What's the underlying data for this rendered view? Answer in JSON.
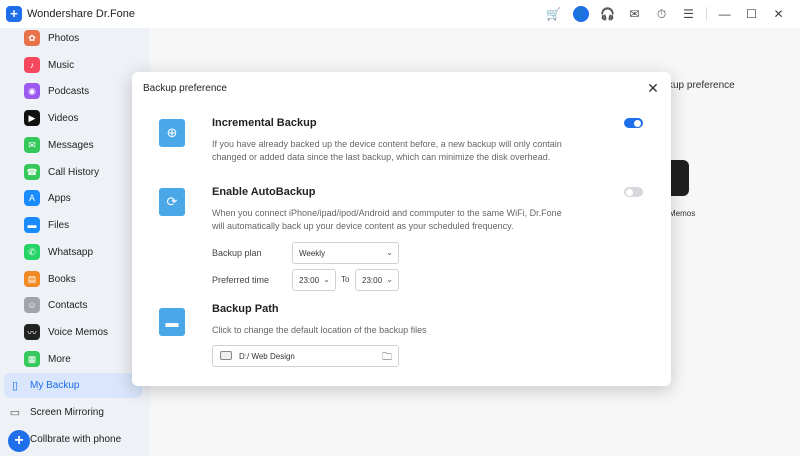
{
  "app": {
    "title": "Wondershare Dr.Fone",
    "logo_glyph": "+"
  },
  "titlebar": {
    "icons": [
      "cart-icon",
      "avatar-icon",
      "headset-icon",
      "mail-icon",
      "history-icon",
      "list-icon",
      "minimize-icon",
      "maximize-icon",
      "close-icon"
    ]
  },
  "sidebar": {
    "items": [
      {
        "label": "Photos",
        "icon": "photos-icon",
        "color": "#e8734a"
      },
      {
        "label": "Music",
        "icon": "music-icon",
        "color": "#f5485f"
      },
      {
        "label": "Podcasts",
        "icon": "podcasts-icon",
        "color": "#9b59f0"
      },
      {
        "label": "Videos",
        "icon": "videos-icon",
        "color": "#111111"
      },
      {
        "label": "Messages",
        "icon": "messages-icon",
        "color": "#34c759"
      },
      {
        "label": "Call History",
        "icon": "call-icon",
        "color": "#34c759"
      },
      {
        "label": "Apps",
        "icon": "apps-icon",
        "color": "#1a8cff"
      },
      {
        "label": "Files",
        "icon": "files-icon",
        "color": "#1a8cff"
      },
      {
        "label": "Whatsapp",
        "icon": "whatsapp-icon",
        "color": "#25d366"
      },
      {
        "label": "Books",
        "icon": "books-icon",
        "color": "#f08a24"
      },
      {
        "label": "Contacts",
        "icon": "contacts-icon",
        "color": "#a0a4aa"
      },
      {
        "label": "Voice Memos",
        "icon": "voice-memos-icon",
        "color": "#222222"
      },
      {
        "label": "More",
        "icon": "more-icon",
        "color": "#34c759"
      }
    ],
    "sections": [
      {
        "label": "My Backup",
        "icon": "phone-icon"
      },
      {
        "label": "Screen Mirroring",
        "icon": "screen-icon"
      },
      {
        "label": "Collbrate with phone",
        "icon": "collab-icon"
      }
    ]
  },
  "background": {
    "heading_fragment": "kup preference",
    "memo_label": "Memos"
  },
  "dialog": {
    "title": "Backup preference",
    "close_glyph": "✕",
    "incremental": {
      "title": "Incremental Backup",
      "description": "If you have already backed up the device content before, a new backup will only contain changed or added data since the last backup, which can minimize the disk overhead.",
      "enabled": true
    },
    "autobackup": {
      "title": "Enable AutoBackup",
      "description": "When you connect iPhone/ipad/ipod/Android and commputer to the same WiFi, Dr.Fone will automatically back up your device content as your scheduled frequency.",
      "enabled": false,
      "plan_label": "Backup plan",
      "plan_value": "Weekly",
      "time_label": "Preferred time",
      "time_from": "23:00",
      "to_label": "To",
      "time_to": "23:00"
    },
    "path": {
      "title": "Backup Path",
      "description": "Click to change the default location of the backup files",
      "value": "D:/ Web Design"
    }
  },
  "colors": {
    "accent": "#1f6fea",
    "icon_blue": "#4aa8e8",
    "sidebar_bg": "#eef1f6",
    "active_bg": "#d9e6fb"
  }
}
